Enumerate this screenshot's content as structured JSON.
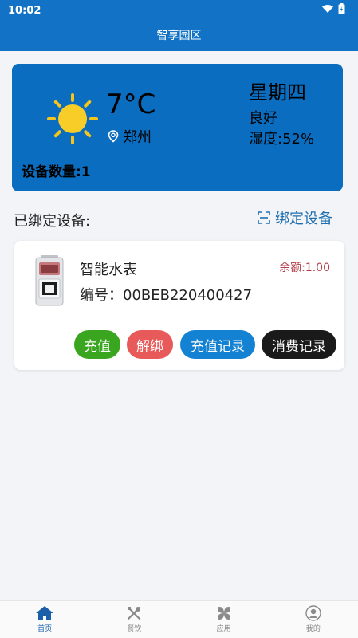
{
  "status_bar": {
    "time": "10:02"
  },
  "header": {
    "title": "智享园区"
  },
  "weather": {
    "temperature": "7°C",
    "city": "郑州",
    "weekday": "星期四",
    "air_quality": "良好",
    "humidity": "湿度:52%",
    "device_count": "设备数量:1",
    "icon": "sun-icon"
  },
  "devices_section": {
    "title": "已绑定设备:",
    "bind_label": "绑定设备"
  },
  "device": {
    "name": "智能水表",
    "code": "编号：00BEB220400427",
    "balance": "余额:1.00",
    "buttons": {
      "recharge": "充值",
      "unbind": "解绑",
      "recharge_log": "充值记录",
      "consume_log": "消费记录"
    }
  },
  "tabbar": {
    "items": [
      {
        "label": "首页",
        "icon": "home-icon",
        "active": true
      },
      {
        "label": "餐饮",
        "icon": "utensils-icon",
        "active": false
      },
      {
        "label": "应用",
        "icon": "apps-icon",
        "active": false
      },
      {
        "label": "我的",
        "icon": "profile-icon",
        "active": false
      }
    ]
  },
  "colors": {
    "primary": "#1273c6",
    "recharge": "#3aa61f",
    "unbind": "#e85a5a",
    "recharge_log": "#1482d2",
    "consume_log": "#1a1a1a",
    "balance": "#b53c49"
  }
}
